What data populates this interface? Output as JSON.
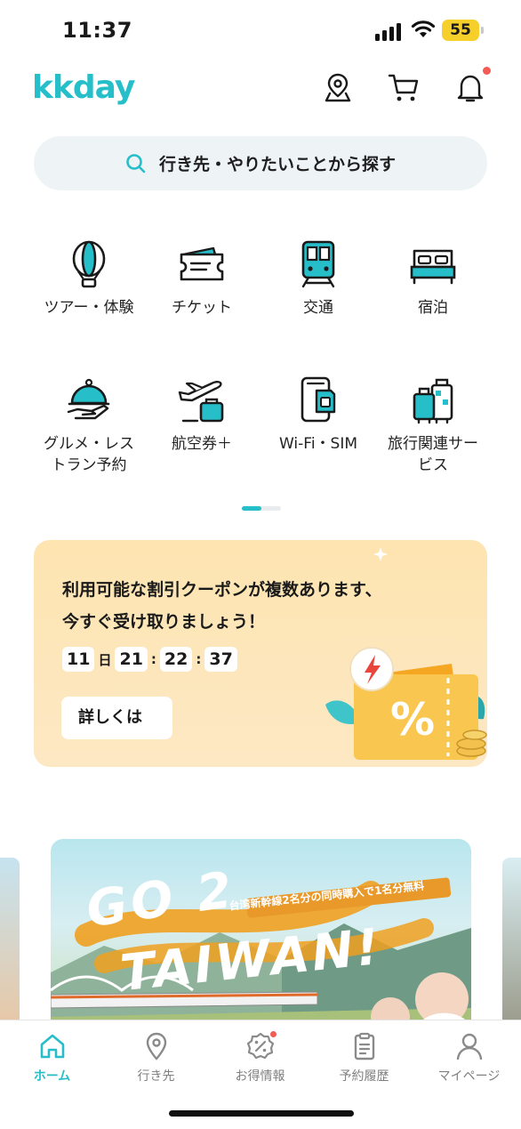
{
  "status_bar": {
    "time": "11:37",
    "battery": "55"
  },
  "header": {
    "logo": "kkday"
  },
  "search": {
    "placeholder": "行き先・やりたいことから探す"
  },
  "categories": [
    {
      "label": "ツアー・体験",
      "icon": "balloon-icon"
    },
    {
      "label": "チケット",
      "icon": "ticket-icon"
    },
    {
      "label": "交通",
      "icon": "train-icon"
    },
    {
      "label": "宿泊",
      "icon": "bed-icon"
    },
    {
      "label": "グルメ・レストラン予約",
      "icon": "cloche-icon"
    },
    {
      "label": "航空券＋",
      "icon": "airplane-icon"
    },
    {
      "label": "Wi-Fi・SIM",
      "icon": "sim-icon"
    },
    {
      "label": "旅行関連サービス",
      "icon": "luggage-icon"
    }
  ],
  "coupon": {
    "line1": "利用可能な割引クーポンが複数あります、",
    "line2": "今すぐ受け取りましょう！",
    "days": "11",
    "day_unit": "日",
    "hours": "21",
    "minutes": "22",
    "seconds": "37",
    "button": "詳しくは"
  },
  "promo": {
    "headline1": "GO 2",
    "headline2": "TAIWAN!",
    "ribbon": "台湾新幹線2名分の同時購入で1名分無料"
  },
  "bottom_nav": [
    {
      "label": "ホーム",
      "icon": "home-icon",
      "active": true
    },
    {
      "label": "行き先",
      "icon": "map-pin-icon"
    },
    {
      "label": "お得情報",
      "icon": "discount-badge-icon"
    },
    {
      "label": "予約履歴",
      "icon": "clipboard-icon"
    },
    {
      "label": "マイページ",
      "icon": "user-icon"
    }
  ],
  "colors": {
    "brand": "#26bec9",
    "badge": "#f25c54",
    "coupon_bg": "#fde4b0"
  }
}
